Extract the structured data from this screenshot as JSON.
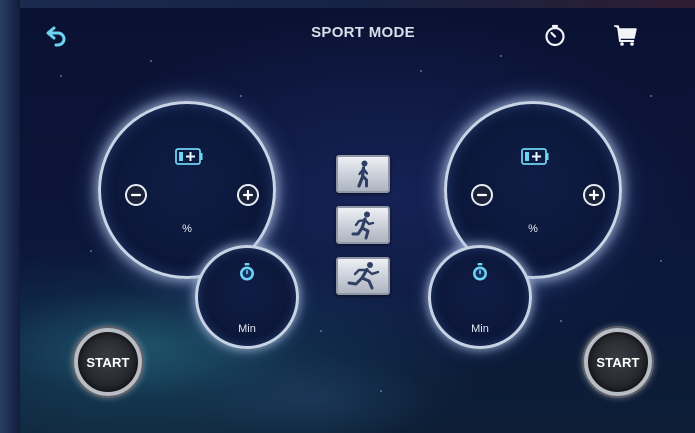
{
  "header": {
    "title": "SPORT MODE",
    "back_icon": "back-arrow-icon",
    "timer_icon": "stopwatch-icon",
    "cart_icon": "cart-icon"
  },
  "left_panel": {
    "power_unit": "%",
    "battery_icon": "battery-icon",
    "decrease_icon": "minus-icon",
    "increase_icon": "plus-icon",
    "timer_unit": "Min",
    "start_label": "START"
  },
  "right_panel": {
    "power_unit": "%",
    "battery_icon": "battery-icon",
    "decrease_icon": "minus-icon",
    "increase_icon": "plus-icon",
    "timer_unit": "Min",
    "start_label": "START"
  },
  "modes": [
    {
      "icon": "walking-icon"
    },
    {
      "icon": "jogging-icon"
    },
    {
      "icon": "running-icon"
    }
  ],
  "colors": {
    "background": "#0b1230",
    "accent": "#6fd3f2",
    "dial_ring": "#c9d4e6"
  }
}
